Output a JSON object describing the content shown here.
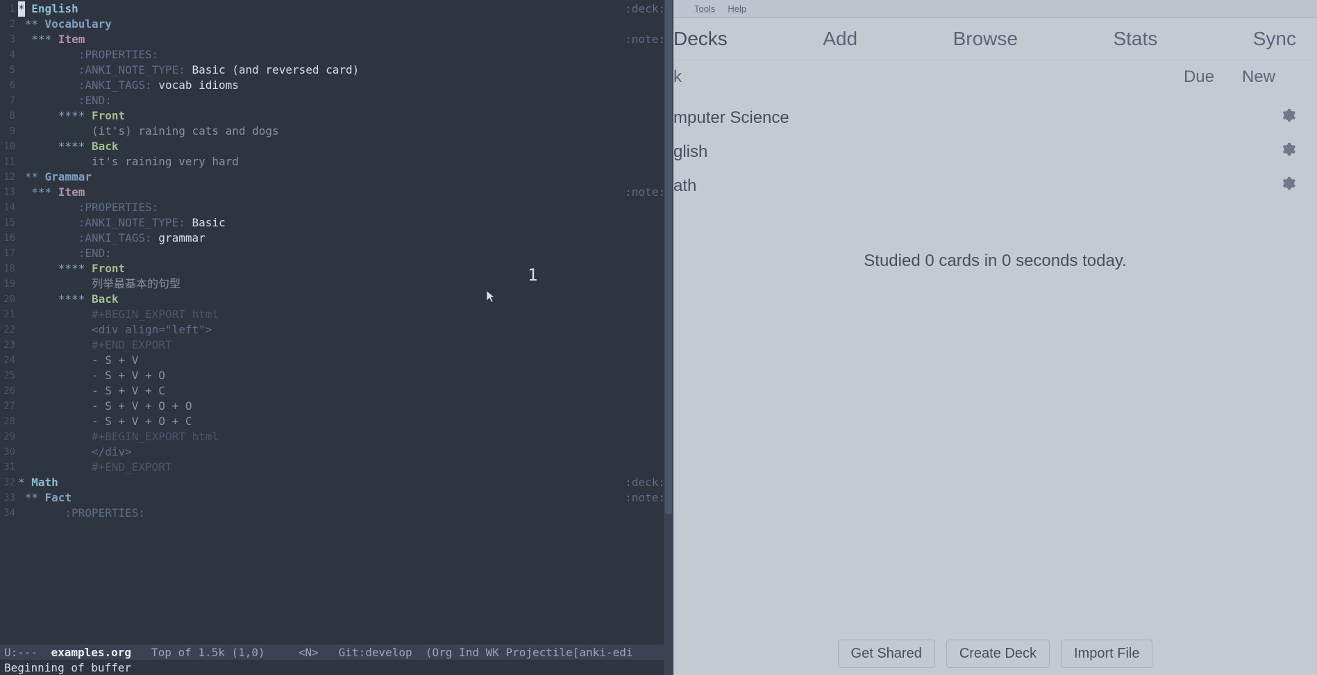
{
  "editor": {
    "overlay_number": "1",
    "modeline": {
      "prefix": "U:---  ",
      "file": "examples.org",
      "position": "   Top of 1.5k (1,0)     ",
      "mode_marker": "<N>",
      "vcs": "   Git:develop  ",
      "modes": "(Org Ind WK Projectile[anki-edi"
    },
    "minibuffer": "Beginning of buffer",
    "lines": [
      {
        "n": "1",
        "stars": "*",
        "starClass": "cursor-cell",
        "head": " English",
        "headClass": "heading1",
        "rtag": ":deck:"
      },
      {
        "n": "2",
        "indent": " ",
        "stars": "**",
        "starClass": "star",
        "head": " Vocabulary",
        "headClass": "heading2"
      },
      {
        "n": "3",
        "indent": "  ",
        "stars": "***",
        "starClass": "star",
        "head": " Item",
        "headClass": "heading3",
        "rtag": ":note:"
      },
      {
        "n": "4",
        "indent": "         ",
        "text": ":PROPERTIES:",
        "textClass": "prop-key"
      },
      {
        "n": "5",
        "indent": "         ",
        "key": ":ANKI_NOTE_TYPE:",
        "val": " Basic (and reversed card)"
      },
      {
        "n": "6",
        "indent": "         ",
        "key": ":ANKI_TAGS:",
        "val": " vocab idioms"
      },
      {
        "n": "7",
        "indent": "         ",
        "text": ":END:",
        "textClass": "prop-key"
      },
      {
        "n": "8",
        "indent": "      ",
        "stars": "****",
        "starClass": "star",
        "head": " Front",
        "headClass": "heading4"
      },
      {
        "n": "9",
        "indent": "           ",
        "text": "(it's) raining cats and dogs",
        "textClass": "body-text"
      },
      {
        "n": "10",
        "indent": "      ",
        "stars": "****",
        "starClass": "star",
        "head": " Back",
        "headClass": "heading4"
      },
      {
        "n": "11",
        "indent": "           ",
        "text": "it's raining very hard",
        "textClass": "body-text"
      },
      {
        "n": "12",
        "indent": " ",
        "stars": "**",
        "starClass": "star",
        "head": " Grammar",
        "headClass": "heading2"
      },
      {
        "n": "13",
        "indent": "  ",
        "stars": "***",
        "starClass": "star",
        "head": " Item",
        "headClass": "heading3",
        "rtag": ":note:"
      },
      {
        "n": "14",
        "indent": "         ",
        "text": ":PROPERTIES:",
        "textClass": "prop-key"
      },
      {
        "n": "15",
        "indent": "         ",
        "key": ":ANKI_NOTE_TYPE:",
        "val": " Basic"
      },
      {
        "n": "16",
        "indent": "         ",
        "key": ":ANKI_TAGS:",
        "val": " grammar"
      },
      {
        "n": "17",
        "indent": "         ",
        "text": ":END:",
        "textClass": "prop-key"
      },
      {
        "n": "18",
        "indent": "      ",
        "stars": "****",
        "starClass": "star",
        "head": " Front",
        "headClass": "heading4"
      },
      {
        "n": "19",
        "indent": "           ",
        "text": "列举最基本的句型",
        "textClass": "body-text"
      },
      {
        "n": "20",
        "indent": "      ",
        "stars": "****",
        "starClass": "star",
        "head": " Back",
        "headClass": "heading4"
      },
      {
        "n": "21",
        "indent": "           ",
        "text": "#+BEGIN_EXPORT html",
        "textClass": "comment-block"
      },
      {
        "n": "22",
        "indent": "           ",
        "text": "<div align=\"left\">",
        "textClass": "html-text"
      },
      {
        "n": "23",
        "indent": "           ",
        "text": "#+END_EXPORT",
        "textClass": "comment-block"
      },
      {
        "n": "24",
        "indent": "           ",
        "text": "- S + V",
        "textClass": "body-text"
      },
      {
        "n": "25",
        "indent": "           ",
        "text": "- S + V + O",
        "textClass": "body-text"
      },
      {
        "n": "26",
        "indent": "           ",
        "text": "- S + V + C",
        "textClass": "body-text"
      },
      {
        "n": "27",
        "indent": "           ",
        "text": "- S + V + O + O",
        "textClass": "body-text"
      },
      {
        "n": "28",
        "indent": "           ",
        "text": "- S + V + O + C",
        "textClass": "body-text"
      },
      {
        "n": "29",
        "indent": "           ",
        "text": "#+BEGIN_EXPORT html",
        "textClass": "comment-block"
      },
      {
        "n": "30",
        "indent": "           ",
        "text": "</div>",
        "textClass": "html-text"
      },
      {
        "n": "31",
        "indent": "           ",
        "text": "#+END_EXPORT",
        "textClass": "comment-block"
      },
      {
        "n": "32",
        "stars": "*",
        "starClass": "star",
        "head": " Math",
        "headClass": "heading1",
        "rtag": ":deck:"
      },
      {
        "n": "33",
        "indent": " ",
        "stars": "**",
        "starClass": "star",
        "head": " Fact",
        "headClass": "heading2",
        "rtag": ":note:"
      },
      {
        "n": "34",
        "indent": "       ",
        "text": ":PROPERTIES:",
        "textClass": "prop-key"
      }
    ]
  },
  "anki": {
    "menu": {
      "tools": "Tools",
      "help": "Help"
    },
    "tabs": {
      "decks": "Decks",
      "add": "Add",
      "browse": "Browse",
      "stats": "Stats",
      "sync": "Sync"
    },
    "columns": {
      "deck": "k",
      "due": "Due",
      "new": "New"
    },
    "decks": [
      {
        "name": "mputer Science"
      },
      {
        "name": "glish"
      },
      {
        "name": "ath"
      }
    ],
    "studied_msg": "Studied 0 cards in 0 seconds today.",
    "buttons": {
      "shared": "Get Shared",
      "create": "Create Deck",
      "import": "Import File"
    }
  }
}
